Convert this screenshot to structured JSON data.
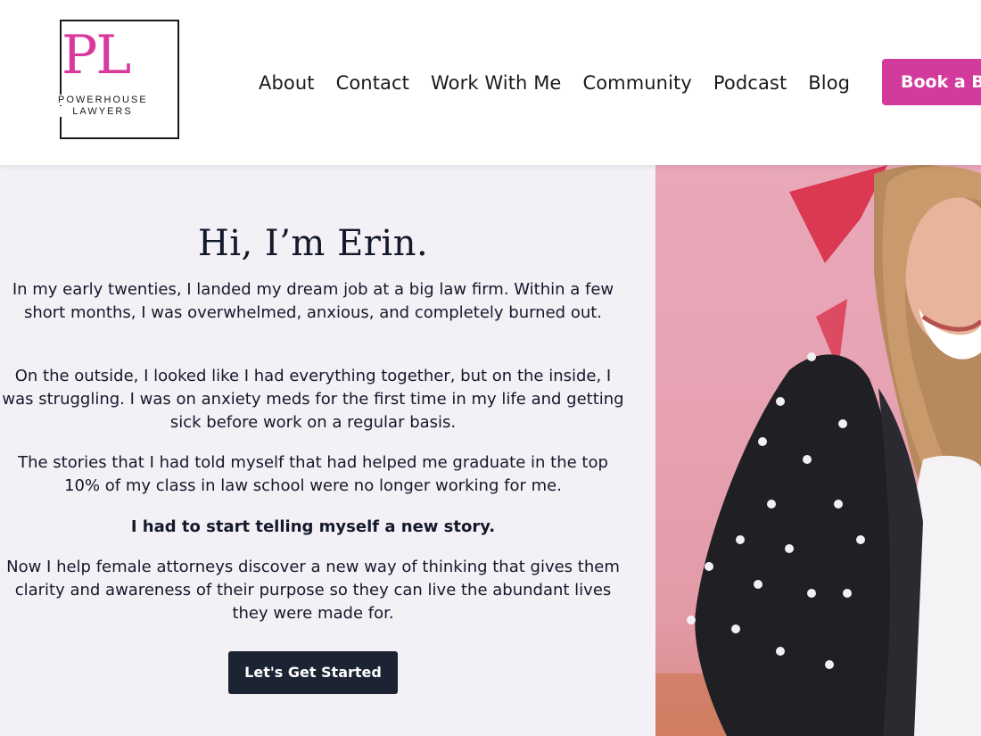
{
  "logo": {
    "letters": "PL",
    "line1": "POWERHOUSE",
    "line2": "LAWYERS"
  },
  "nav": {
    "items": [
      "About",
      "Contact",
      "Work With Me",
      "Community",
      "Podcast",
      "Blog"
    ],
    "book_button": "Book a Br"
  },
  "hero": {
    "title": "Hi, I’m Erin.",
    "p1": "In my early twenties, I landed my dream job at a big law firm. Within a few short months, I was overwhelmed, anxious, and completely burned out.",
    "p2": "On the outside, I looked like I had everything together, but on the inside, I was struggling. I was on anxiety meds for the first time in my life and getting sick before work on a regular basis.",
    "p3": "The stories that I had told myself that had helped me graduate in the top 10% of my class in law school were no longer working for me.",
    "p4": "I had to start telling myself a new story.",
    "p5": "Now I help female attorneys discover a new way of thinking that gives them clarity and awareness of their purpose so they can live the abundant lives they were made for.",
    "cta": "Let's Get Started"
  },
  "colors": {
    "brand_pink": "#d23a9b",
    "dark_navy": "#1c2333",
    "section_bg": "#f3f1f6"
  }
}
